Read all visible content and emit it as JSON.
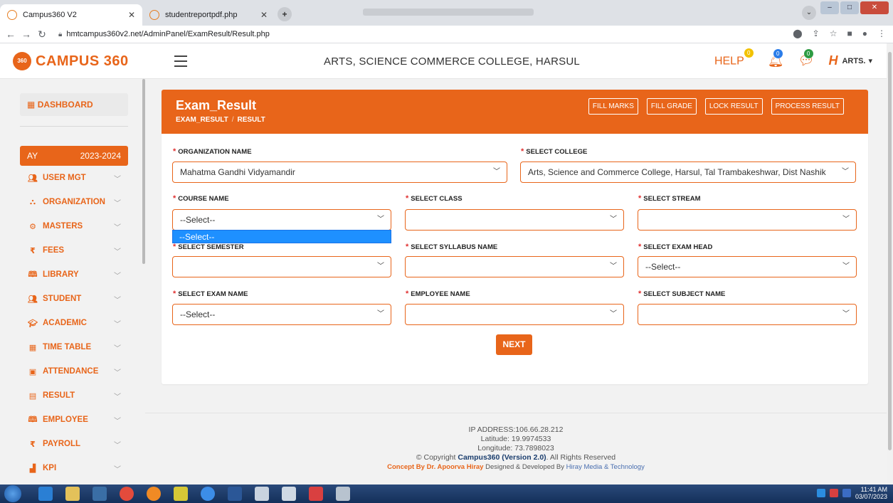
{
  "browser": {
    "tabs": [
      {
        "label": "Campus360 V2",
        "active": true
      },
      {
        "label": "studentreportpdf.php",
        "active": false
      }
    ],
    "url": "hmtcampus360v2.net/AdminPanel/ExamResult/Result.php"
  },
  "header": {
    "logo_text": "CAMPUS 360",
    "logo_badge": "360",
    "college_title": "ARTS, SCIENCE COMMERCE COLLEGE, HARSUL",
    "help_label": "HELP",
    "help_count": "0",
    "notif_count": "0",
    "msg_count": "0",
    "user_label": "ARTS.",
    "user_logo": "H"
  },
  "sidebar": {
    "dashboard": "DASHBOARD",
    "ay_label": "AY",
    "ay_value": "2023-2024",
    "items": [
      {
        "label": "USER MGT",
        "icon": "users-icon"
      },
      {
        "label": "ORGANIZATION",
        "icon": "org-icon"
      },
      {
        "label": "MASTERS",
        "icon": "gear-icon"
      },
      {
        "label": "FEES",
        "icon": "rupee-icon"
      },
      {
        "label": "LIBRARY",
        "icon": "book-icon"
      },
      {
        "label": "STUDENT",
        "icon": "users-icon"
      },
      {
        "label": "ACADEMIC",
        "icon": "graduation-cap-icon"
      },
      {
        "label": "TIME TABLE",
        "icon": "calendar-icon"
      },
      {
        "label": "ATTENDANCE",
        "icon": "clipboard-icon"
      },
      {
        "label": "RESULT",
        "icon": "result-icon"
      },
      {
        "label": "EMPLOYEE",
        "icon": "book-icon"
      },
      {
        "label": "PAYROLL",
        "icon": "rupee-icon"
      },
      {
        "label": "KPI",
        "icon": "bar-chart-icon"
      }
    ]
  },
  "page": {
    "title": "Exam_Result",
    "breadcrumb": [
      "EXAM_RESULT",
      "RESULT"
    ],
    "buttons": {
      "fill_marks": "FILL MARKS",
      "fill_grade": "FILL GRADE",
      "lock_result": "LOCK RESULT",
      "process_result": "PROCESS RESULT"
    },
    "fields": {
      "org_name": {
        "label": "ORGANIZATION NAME",
        "value": "Mahatma Gandhi Vidyamandir"
      },
      "college": {
        "label": "SELECT COLLEGE",
        "value": "Arts, Science and Commerce College, Harsul, Tal Trambakeshwar, Dist Nashik"
      },
      "course": {
        "label": "COURSE NAME",
        "value": "--Select--"
      },
      "class": {
        "label": "SELECT CLASS",
        "value": ""
      },
      "stream": {
        "label": "SELECT STREAM",
        "value": ""
      },
      "semester": {
        "label": "SELECT SEMESTER",
        "value": ""
      },
      "syllabus": {
        "label": "SELECT SYLLABUS NAME",
        "value": ""
      },
      "exam_head": {
        "label": "SELECT EXAM HEAD",
        "value": "--Select--"
      },
      "exam_name": {
        "label": "SELECT EXAM NAME",
        "value": "--Select--"
      },
      "employee": {
        "label": "EMPLOYEE NAME",
        "value": ""
      },
      "subject": {
        "label": "SELECT SUBJECT NAME",
        "value": ""
      }
    },
    "course_dropdown_option": "--Select--",
    "next_label": "NEXT"
  },
  "footer": {
    "ip": "IP ADDRESS:106.66.28.212",
    "latitude": "Latitude: 19.9974533",
    "longitude": "Longitude: 73.7898023",
    "copyright_prefix": "© Copyright ",
    "copyright_brand": "Campus360 (Version 2.0)",
    "copyright_suffix": ". All Rights Reserved",
    "concept_by": "Concept By Dr. Apoorva Hiray",
    "designed_by": " Designed & Developed By ",
    "developer": "Hiray Media & Technology"
  },
  "taskbar": {
    "time": "11:41 AM",
    "date": "03/07/2023"
  },
  "colors": {
    "accent": "#e8651a",
    "dropdown_highlight": "#1e90ff"
  }
}
